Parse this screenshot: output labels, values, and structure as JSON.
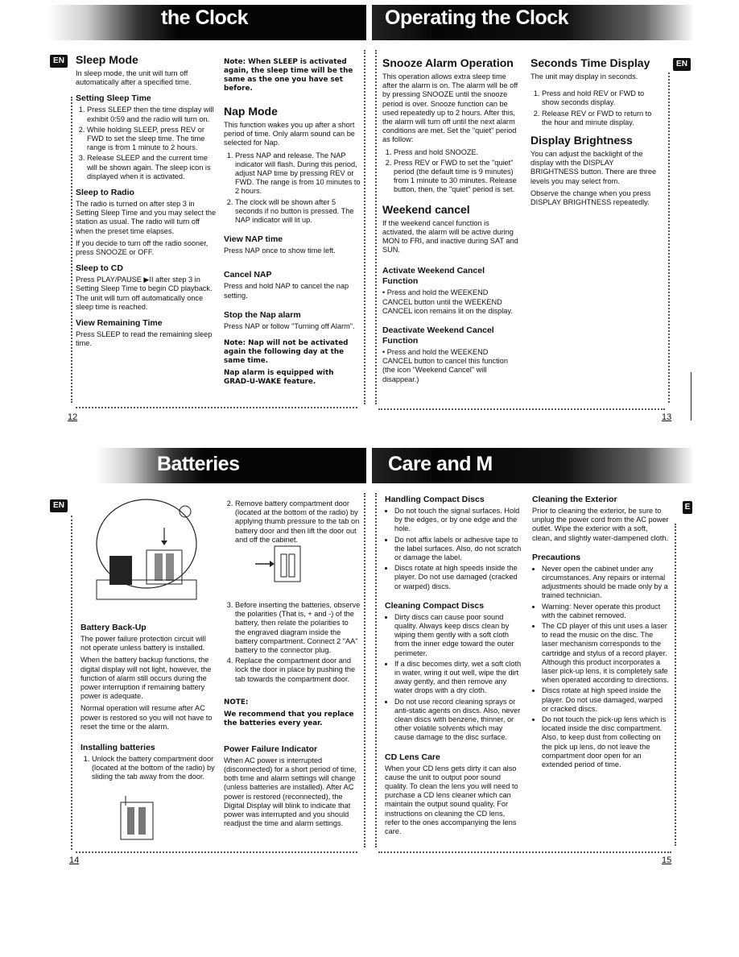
{
  "page12": {
    "banner_title": "the Clock",
    "badge": "EN",
    "page_number": "12",
    "sleep_mode": {
      "title": "Sleep Mode",
      "intro": "In sleep mode, the unit will turn off automatically after a specified time.",
      "setting_title": "Setting Sleep Time",
      "steps": [
        "Press SLEEP then the time display will exhibit 0:59 and the radio will turn on.",
        "While holding SLEEP, press REV or FWD to set the sleep time. The time range is from 1 minute to 2 hours.",
        "Release SLEEP and the current time will be shown again. The sleep icon is displayed when it is activated."
      ],
      "radio_title": "Sleep to Radio",
      "radio_text1": "The radio is turned on after step 3 in Setting Sleep Time and you may select the station as usual. The radio will turn off when the preset time elapses.",
      "radio_text2": "If you decide to turn off the radio sooner, press SNOOZE or OFF.",
      "cd_title": "Sleep to CD",
      "cd_text": "Press PLAY/PAUSE ▶II after step 3 in Setting Sleep Time to begin CD playback. The unit will turn off automatically once sleep time is reached.",
      "remaining_title": "View Remaining Time",
      "remaining_text": "Press SLEEP to read the remaining sleep time."
    },
    "note_sleep": "Note: When SLEEP is activated again, the sleep time will be the same as the one you have set before.",
    "nap_mode": {
      "title": "Nap Mode",
      "intro": "This function wakes you up after a short period of time. Only alarm sound can be selected for Nap.",
      "steps": [
        "Press NAP and release. The NAP indicator will flash. During this period, adjust NAP time by pressing REV or FWD. The range is from 10 minutes to 2 hours.",
        "The clock will be shown after 5 seconds if no button is pressed. The NAP indicator will lit up."
      ],
      "view_title": "View NAP time",
      "view_text": "Press NAP once to show time left.",
      "cancel_title": "Cancel NAP",
      "cancel_text": "Press and hold NAP to cancel the nap setting.",
      "stop_title": "Stop the Nap alarm",
      "stop_text": "Press NAP or follow \"Turning off Alarm\".",
      "note1": "Note: Nap will not be activated again the following day at the same time.",
      "note2": "Nap alarm is equipped with GRAD-U-WAKE feature."
    }
  },
  "page13": {
    "banner_title": "Operating the Clock",
    "badge": "EN",
    "page_number": "13",
    "snooze": {
      "title": "Snooze Alarm Operation",
      "intro": "This operation allows extra sleep time after the alarm is on. The alarm will be off by pressing SNOOZE until the snooze period is over. Snooze function can be used repeatedly up to 2 hours. After this, the alarm will turn off until the next alarm conditions are met. Set the \"quiet\" period as follow:",
      "steps": [
        "Press and hold SNOOZE.",
        "Press REV or FWD to set the \"quiet\" period (the default time is 9 minutes) from 1 minute to 30 minutes. Release button, then, the \"quiet\" period is set."
      ]
    },
    "weekend": {
      "title": "Weekend cancel",
      "text": "If the weekend cancel function is activated, the alarm will be active during MON to FRI, and inactive during SAT and SUN.",
      "activate_title": "Activate Weekend Cancel Function",
      "activate_text": "• Press and hold the WEEKEND CANCEL button until the WEEKEND CANCEL icon remains lit on the display.",
      "deactivate_title": "Deactivate Weekend Cancel Function",
      "deactivate_text": "• Press and hold the WEEKEND CANCEL button to cancel this function (the icon \"Weekend Cancel\" will disappear.)"
    },
    "seconds": {
      "title": "Seconds Time Display",
      "intro": "The unit may display in seconds.",
      "steps": [
        "Press and hold REV or FWD to show seconds display.",
        "Release REV or FWD to return to the hour and minute display."
      ]
    },
    "brightness": {
      "title": "Display Brightness",
      "text1": "You can adjust the backlight of the display with the DISPLAY BRIGHTNESS button. There are three levels you may select from.",
      "text2": "Observe the change when you press DISPLAY BRIGHTNESS repeatedly."
    }
  },
  "page14": {
    "banner_title": "Batteries",
    "badge": "EN",
    "page_number": "14",
    "backup_title": "Battery Back-Up",
    "backup_text1": "The power failure protection circuit will not operate unless battery is installed.",
    "backup_text2": "When the battery backup functions, the digital display will not light, however, the function of alarm still occurs during the power interruption if remaining battery power is adequate.",
    "backup_text3": "Normal operation will resume after AC power is restored so you will not have to reset the time or the alarm.",
    "installing_title": "Installing batteries",
    "steps": [
      "Unlock the battery compartment door (located at the bottom of the radio) by sliding the tab away from the door.",
      "Remove battery compartment door (located at the bottom of the radio) by applying thumb pressure to the tab on battery door and then lift the door out and off the cabinet.",
      "Before inserting the batteries, observe the polarities (That is, + and -) of the battery, then relate the polarities to the engraved diagram inside the battery compartment. Connect 2 \"AA\" battery to the connector plug.",
      "Replace the compartment door and lock the door in place by pushing the tab towards the compartment door."
    ],
    "note_title": "NOTE:",
    "note_text": "We recommend that you replace the batteries every year.",
    "power_title": "Power Failure Indicator",
    "power_text": "When AC power is interrupted (disconnected) for a short period of time, both time and alarm settings will change (unless batteries are installed). After AC power is restored (reconnected), the Digital Display will blink to indicate that power was interrupted and you should readjust the time and alarm settings."
  },
  "page15": {
    "banner_title": "Care and M",
    "badge": "E",
    "page_number": "15",
    "handling_title": "Handling Compact Discs",
    "handling_items": [
      "Do not touch the signal surfaces. Hold by the edges, or by one edge and the hole.",
      "Do not affix labels or adhesive tape to the label surfaces. Also, do not scratch or damage the label.",
      "Discs rotate at high speeds inside the player. Do not use damaged (cracked or warped) discs."
    ],
    "cleaning_title": "Cleaning Compact Discs",
    "cleaning_items": [
      "Dirty discs can cause poor sound quality. Always keep discs clean by wiping them gently with a soft cloth from the inner edge toward the outer perimeter.",
      "If a disc becomes dirty, wet a soft cloth in water, wring it out well, wipe the dirt away gently, and then remove any water drops with a dry cloth.",
      "Do not use record cleaning sprays or anti-static agents on discs. Also, never clean discs with benzene, thinner, or other volatile solvents which may cause damage to the disc surface."
    ],
    "lens_title": "CD Lens Care",
    "lens_text": "When your CD lens gets dirty it can also cause the unit to output poor sound quality. To clean the lens you will need to purchase a CD lens cleaner which can maintain the output sound quality. For instructions on cleaning the CD lens, refer to the ones accompanying the lens care.",
    "exterior_title": "Cleaning the Exterior",
    "exterior_text": "Prior to cleaning the exterior, be sure to unplug the power cord from the AC power outlet. Wipe the exterior with a soft, clean, and slightly water-dampened cloth.",
    "precautions_title": "Precautions",
    "precautions_items": [
      "Never open the cabinet under any circumstances. Any repairs or internal adjustments should be made only by a trained technician.",
      "Warning: Never operate this product with the cabinet removed.",
      "The CD player of this unit uses a laser to read the music on the disc. The laser mechanism corresponds to the cartridge and stylus of a record player. Although this product incorporates a laser pick-up lens, it is completely safe when operated according to directions.",
      "Discs rotate at high speed inside the player. Do not use damaged, warped or cracked discs.",
      "Do not touch the pick-up lens which is located inside the disc compartment. Also, to keep dust from collecting on the pick up lens, do not leave the compartment door open for an extended period of time."
    ]
  }
}
